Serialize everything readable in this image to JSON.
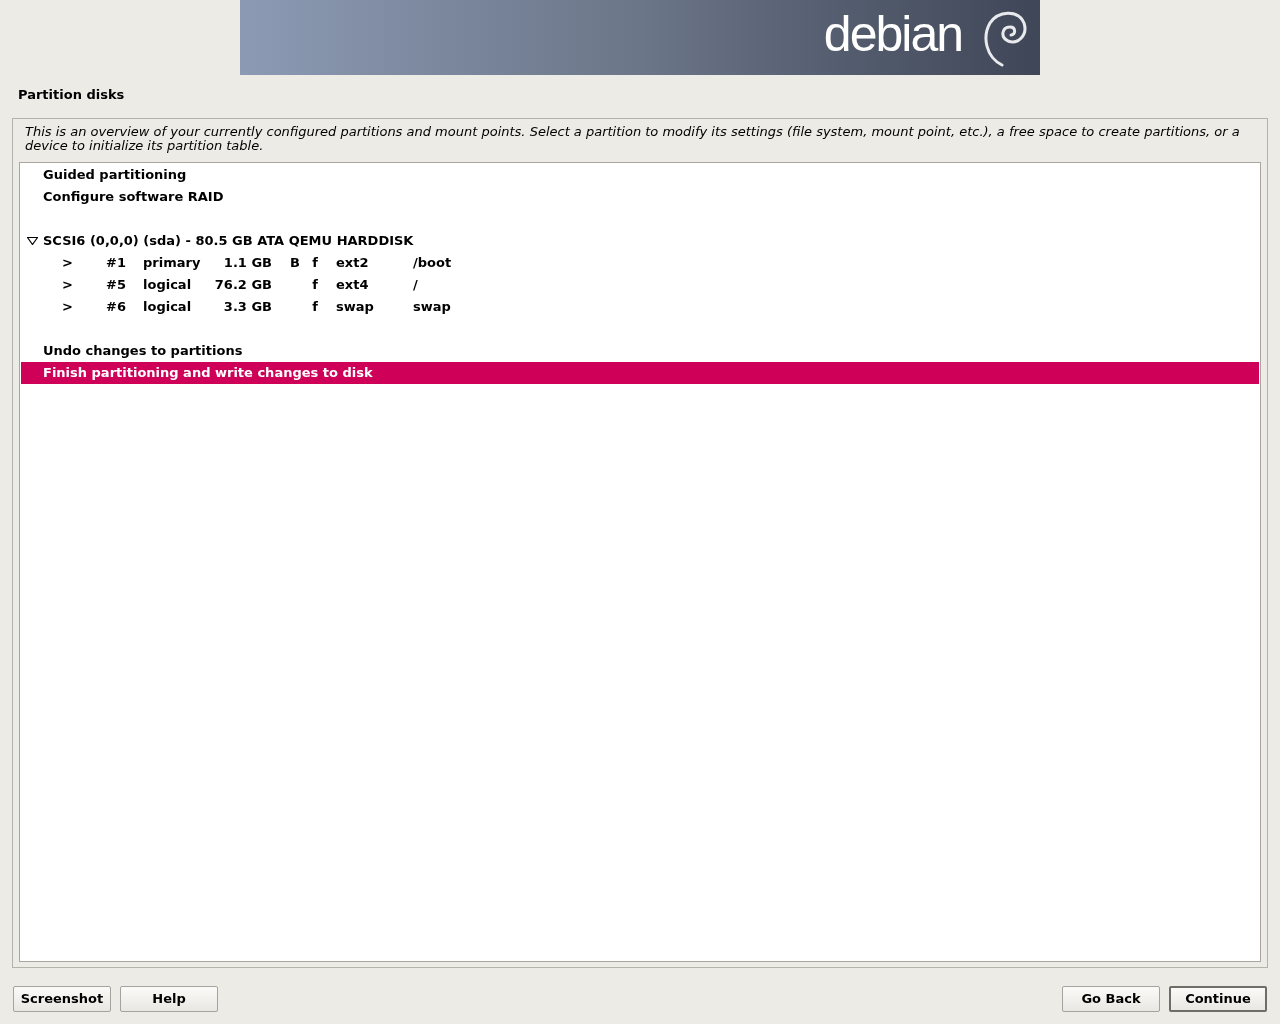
{
  "banner": {
    "logo_text": "debian"
  },
  "title": "Partition disks",
  "description": "This is an overview of your currently configured partitions and mount points. Select a partition to modify its settings (file system, mount point, etc.), a free space to create partitions, or a device to initialize its partition table.",
  "groups": [
    [
      {
        "kind": "action",
        "label": "Guided partitioning",
        "selected": false
      },
      {
        "kind": "action",
        "label": "Configure software RAID",
        "selected": false
      }
    ],
    [
      {
        "kind": "disk",
        "label": "SCSI6 (0,0,0) (sda) - 80.5 GB ATA QEMU HARDDISK",
        "expanded": true,
        "selected": false
      },
      {
        "kind": "partition",
        "selected": false,
        "cells": [
          ">",
          "#1",
          "primary",
          "1.1 GB",
          "B",
          "f",
          "ext2",
          "/boot"
        ]
      },
      {
        "kind": "partition",
        "selected": false,
        "cells": [
          ">",
          "#5",
          "logical",
          "76.2 GB",
          "",
          "f",
          "ext4",
          "/"
        ]
      },
      {
        "kind": "partition",
        "selected": false,
        "cells": [
          ">",
          "#6",
          "logical",
          "3.3 GB",
          "",
          "f",
          "swap",
          "swap"
        ]
      }
    ],
    [
      {
        "kind": "action",
        "label": "Undo changes to partitions",
        "selected": false
      },
      {
        "kind": "action",
        "label": "Finish partitioning and write changes to disk",
        "selected": true
      }
    ]
  ],
  "left_buttons": [
    {
      "label": "Screenshot",
      "default": false
    },
    {
      "label": "Help",
      "default": false
    }
  ],
  "right_buttons": [
    {
      "label": "Go Back",
      "default": false
    },
    {
      "label": "Continue",
      "default": true
    }
  ]
}
